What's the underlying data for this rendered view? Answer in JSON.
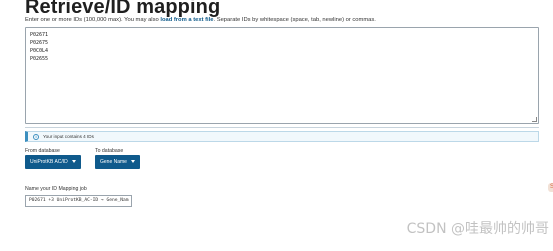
{
  "header": {
    "title": "Retrieve/ID mapping",
    "intro_before": "Enter one or more IDs (100,000 max). You may also ",
    "intro_link": "load from a text file",
    "intro_after": ". Separate IDs by whitespace (space, tab, newline) or commas."
  },
  "ids_input": {
    "lines": [
      "P02671",
      "P02675",
      "P0C0L4",
      "P02655"
    ]
  },
  "info": {
    "icon": "info-circle-icon",
    "text": "Your input contains 4 IDs"
  },
  "from_database": {
    "label": "From database",
    "selected": "UniProtKB AC/ID"
  },
  "to_database": {
    "label": "To database",
    "selected": "Gene Name"
  },
  "job_name": {
    "label": "Name your ID Mapping job",
    "value": "P02671 +3 UniProtKB_AC-ID → Gene_Nam"
  },
  "side_badge": {
    "text": "S"
  },
  "watermark": {
    "text": "CSDN @哇最帅的帅哥"
  },
  "colors": {
    "primary_button": "#0f5a8c",
    "link": "#0e5a8a",
    "info_accent": "#3c8fbf"
  }
}
